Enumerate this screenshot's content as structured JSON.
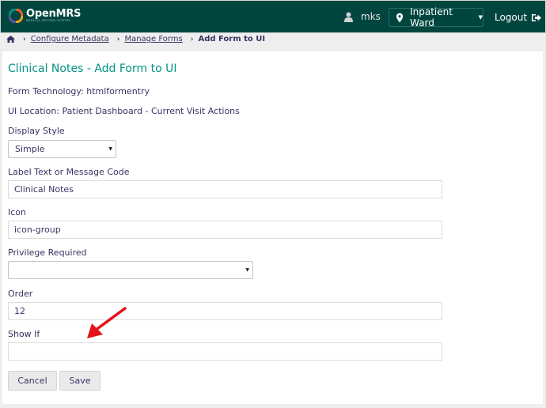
{
  "header": {
    "logo_text": "OpenMRS",
    "logo_subtext": "MEDICAL RECORD SYSTEM",
    "username": "mks",
    "location": "Inpatient Ward",
    "logout_label": "Logout",
    "icons": {
      "user": "user-icon",
      "location": "map-marker-icon",
      "logout": "sign-out-icon"
    }
  },
  "breadcrumb": {
    "home_icon": "home-icon",
    "items": [
      "Configure Metadata",
      "Manage Forms"
    ],
    "current": "Add Form to UI"
  },
  "form": {
    "title": "Clinical Notes - Add Form to UI",
    "technology": "Form Technology: htmlformentry",
    "ui_location": "UI Location: Patient Dashboard - Current Visit Actions",
    "display_style": {
      "label": "Display Style",
      "value": "Simple"
    },
    "label_text": {
      "label": "Label Text or Message Code",
      "value": "Clinical Notes"
    },
    "icon": {
      "label": "Icon",
      "value": "icon-group"
    },
    "privilege": {
      "label": "Privilege Required",
      "value": ""
    },
    "order": {
      "label": "Order",
      "value": "12"
    },
    "show_if": {
      "label": "Show If",
      "value": ""
    },
    "cancel_label": "Cancel",
    "save_label": "Save"
  },
  "colors": {
    "header_bg": "#00463f",
    "title": "#009384",
    "text": "#363463",
    "annotation_arrow": "#e3121b"
  }
}
